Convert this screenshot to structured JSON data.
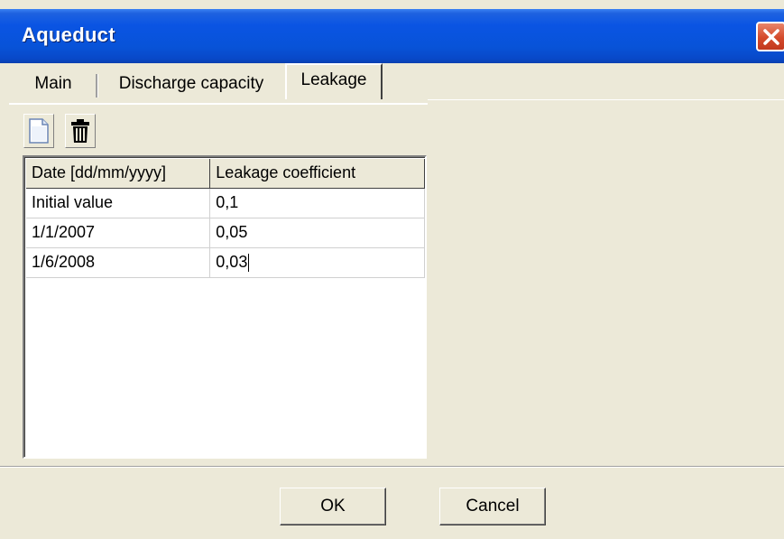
{
  "window": {
    "title": "Aqueduct",
    "close_icon": "close-icon"
  },
  "tabs": [
    {
      "label": "Main",
      "active": false
    },
    {
      "label": "Discharge capacity",
      "active": false
    },
    {
      "label": "Leakage",
      "active": true
    }
  ],
  "toolbar": {
    "new_icon": "new-document-icon",
    "delete_icon": "trash-icon"
  },
  "grid": {
    "columns": [
      "Date [dd/mm/yyyy]",
      "Leakage coefficient"
    ],
    "rows": [
      [
        "Initial value",
        "0,1"
      ],
      [
        "1/1/2007",
        "0,05"
      ],
      [
        "1/6/2008",
        "0,03"
      ]
    ]
  },
  "buttons": {
    "ok": "OK",
    "cancel": "Cancel"
  },
  "colors": {
    "titlebar": "#0A54E3",
    "background": "#ECE9D8",
    "close": "#D44A2B"
  }
}
